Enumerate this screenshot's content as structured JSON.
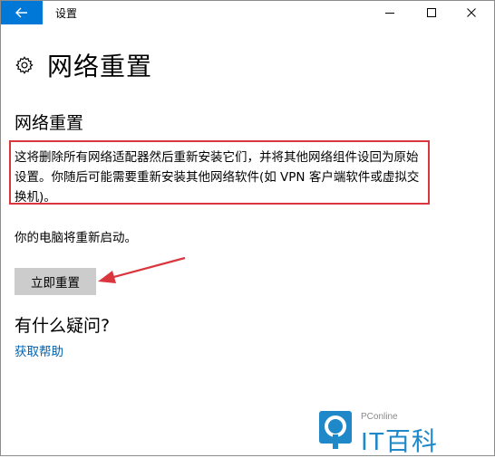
{
  "window": {
    "title": "设置",
    "back_icon": "back-arrow-icon",
    "accent": "#0078d7"
  },
  "page": {
    "title": "网络重置",
    "title_icon": "gear-icon"
  },
  "section": {
    "title": "网络重置",
    "description": "这将删除所有网络适配器然后重新安装它们，并将其他网络组件设回为原始设置。你随后可能需要重新安装其他网络软件(如 VPN 客户端软件或虚拟交换机)。",
    "restart_note": "你的电脑将重新启动。",
    "reset_button": "立即重置"
  },
  "help": {
    "question": "有什么疑问?",
    "link": "获取帮助"
  },
  "watermark": {
    "sub": "PConline",
    "main": "IT百科"
  },
  "annotation_color": "#d9363e"
}
